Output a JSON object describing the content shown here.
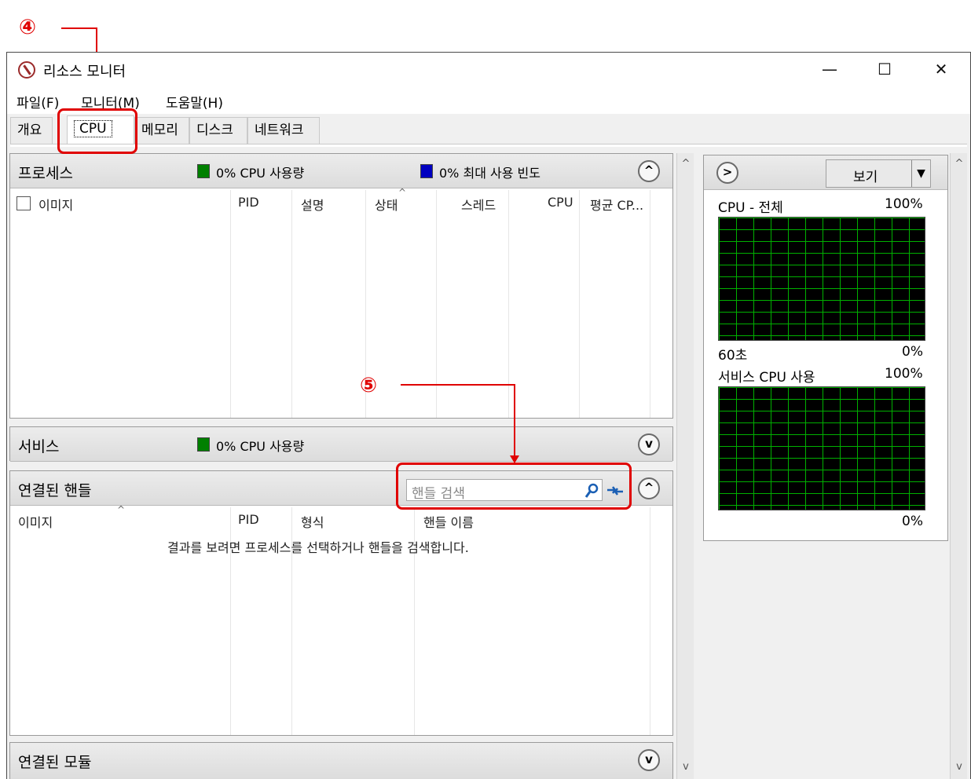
{
  "annotations": {
    "step4": "④",
    "step5": "⑤"
  },
  "window": {
    "title": "리소스 모니터",
    "minimize": "—",
    "maximize": "☐",
    "close": "✕"
  },
  "menu": [
    "파일(F)",
    "모니터(M)",
    "도움말(H)"
  ],
  "tabs": [
    "개요",
    "CPU",
    "메모리",
    "디스크",
    "네트워크"
  ],
  "active_tab": "CPU",
  "processes": {
    "title": "프로세스",
    "cpu_usage": "0% CPU 사용량",
    "max_freq": "0% 최대 사용 빈도",
    "columns": [
      "이미지",
      "PID",
      "설명",
      "상태",
      "스레드",
      "CPU",
      "평균 CP..."
    ],
    "colors": {
      "cpu": "#008000",
      "freq": "#0000c0"
    }
  },
  "services": {
    "title": "서비스",
    "cpu_usage": "0% CPU 사용량"
  },
  "handles": {
    "title": "연결된 핸들",
    "search_placeholder": "핸들 검색",
    "columns": [
      "이미지",
      "PID",
      "형식",
      "핸들 이름"
    ],
    "empty_message": "결과를 보려면 프로세스를 선택하거나 핸들을 검색합니다."
  },
  "modules": {
    "title": "연결된 모듈"
  },
  "right_panel": {
    "view_label": "보기",
    "graph1": {
      "title": "CPU - 전체",
      "max": "100%",
      "time": "60초",
      "min": "0%"
    },
    "graph2": {
      "title": "서비스 CPU 사용",
      "max": "100%",
      "min": "0%"
    }
  },
  "icons": {
    "collapse": "^",
    "expand": "v",
    "scroll_up": "^",
    "scroll_down": "v",
    "forward": ">"
  }
}
